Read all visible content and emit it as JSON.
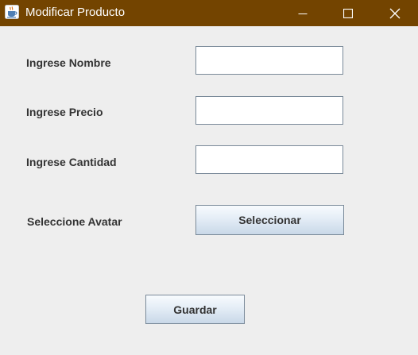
{
  "window": {
    "title": "Modificar Producto",
    "icon": "java-cup-icon",
    "controls": {
      "minimize_icon": "minimize-icon",
      "maximize_icon": "maximize-icon",
      "close_icon": "close-icon"
    },
    "titlebar_color": "#734400"
  },
  "form": {
    "nombre": {
      "label": "Ingrese Nombre",
      "value": ""
    },
    "precio": {
      "label": "Ingrese Precio",
      "value": ""
    },
    "cantidad": {
      "label": "Ingrese Cantidad",
      "value": ""
    },
    "avatar": {
      "label": "Seleccione Avatar",
      "button_label": "Seleccionar"
    },
    "save_label": "Guardar"
  }
}
